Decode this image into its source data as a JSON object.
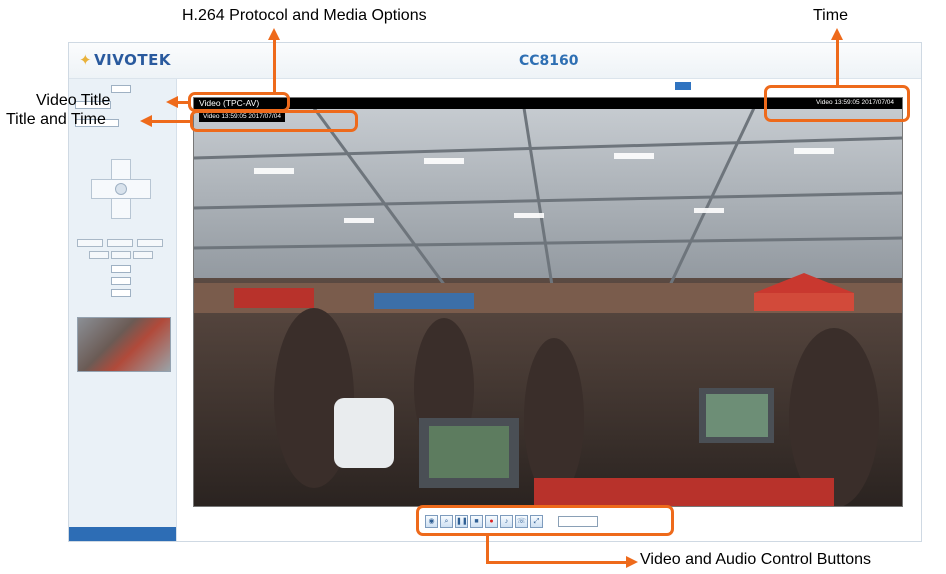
{
  "annotations": {
    "protocol": "H.264 Protocol and Media Options",
    "time": "Time",
    "video_title": "Video Title",
    "title_and_time": "Title and Time",
    "controls": "Video and Audio Control Buttons"
  },
  "header": {
    "logo": "VIVOTEK",
    "model": "CC8160"
  },
  "video": {
    "title_overlay": "Video (TPC-AV)",
    "title_time": "Video 13:59:05  2017/07/04",
    "time_right": "Video 13:59:05  2017/07/04"
  },
  "colors": {
    "accent_orange": "#ee6a1b",
    "brand_blue": "#2e6fb3"
  },
  "icons": [
    "snapshot-icon",
    "digital-zoom-icon",
    "pause-icon",
    "stop-icon",
    "record-icon",
    "volume-icon",
    "talk-icon",
    "fullscreen-icon"
  ]
}
